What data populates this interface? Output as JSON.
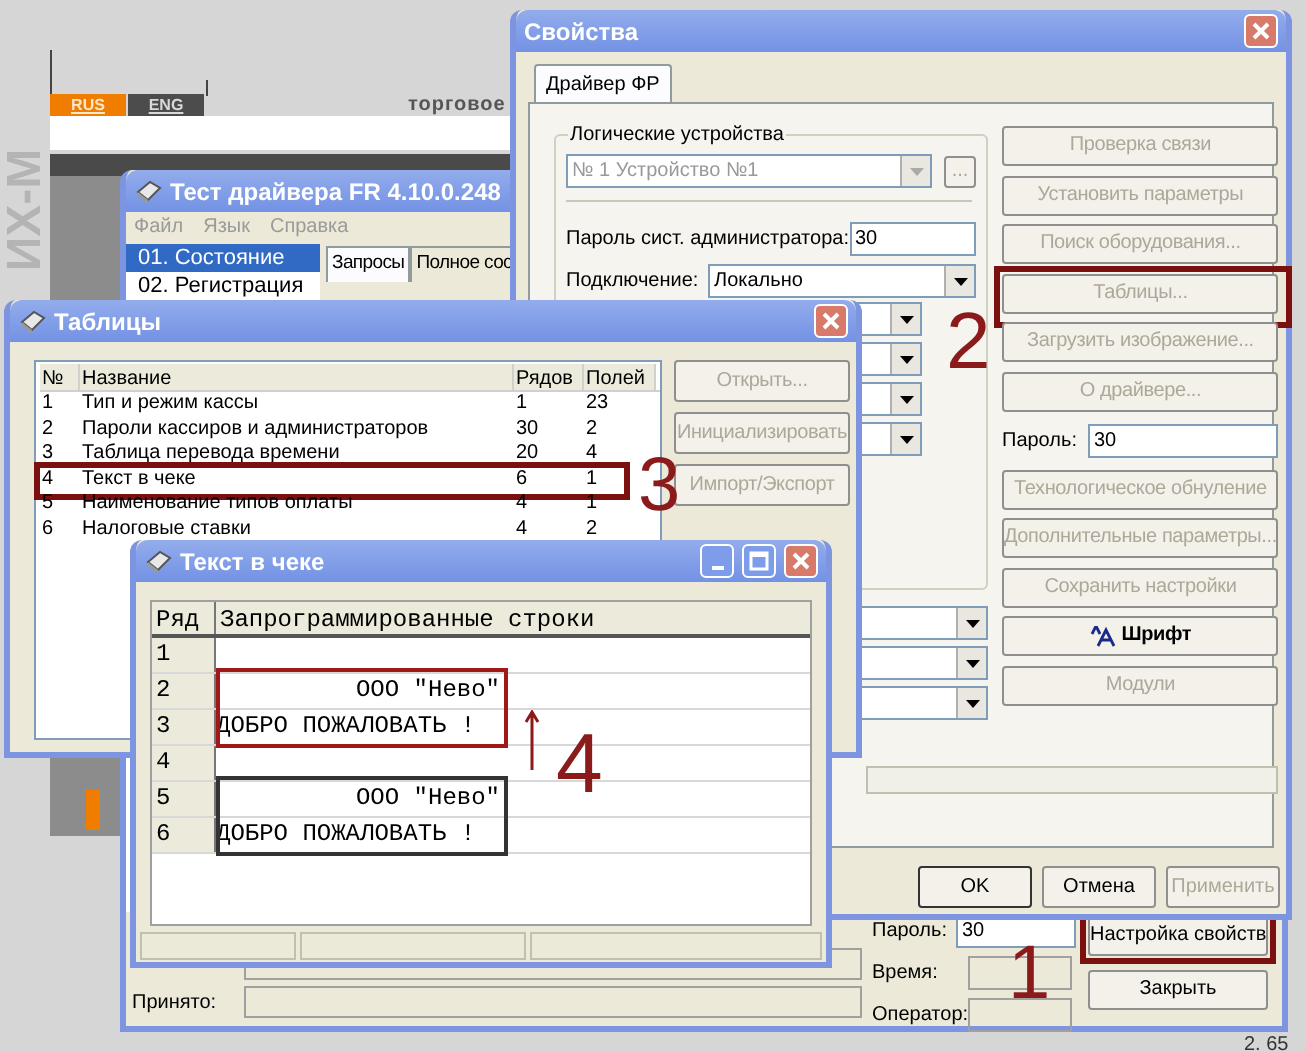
{
  "background": {
    "languages": [
      {
        "label": "RUS",
        "selected": true
      },
      {
        "label": "ENG",
        "selected": false
      }
    ],
    "tagline": "торговое",
    "logo": "ИХ-М",
    "corner_text": "2. 65"
  },
  "main_window": {
    "title": "Тест драйвера FR 4.10.0.248",
    "menu": [
      "Файл",
      "Язык",
      "Справка"
    ],
    "sections": [
      {
        "label": "01. Состояние",
        "selected": true
      },
      {
        "label": "02. Регистрация",
        "selected": false
      }
    ],
    "tabs": [
      {
        "label": "Запросы",
        "selected": true
      },
      {
        "label": "Полное сос",
        "selected": false
      }
    ],
    "fields": [
      {
        "label": "Принято:"
      }
    ],
    "password": {
      "label": "Пароль:",
      "value": "30"
    },
    "time_label": "Время:",
    "operator_label": "Оператор:",
    "buttons": [
      {
        "label": "Настройка свойств",
        "highlighted": true,
        "callout": "1"
      },
      {
        "label": "Закрыть",
        "highlighted": false
      }
    ]
  },
  "properties_window": {
    "title": "Свойства",
    "tabs": [
      {
        "label": "Драйвер ФР",
        "selected": true
      }
    ],
    "group_title": "Логические устройства",
    "device": {
      "value": "№ 1 Устройство №1",
      "disabled": true
    },
    "browse_label": "...",
    "admin_password": {
      "label": "Пароль сист. администратора:",
      "value": "30"
    },
    "connection": {
      "label": "Подключение:",
      "value": "Локально"
    },
    "actions": [
      {
        "kind": "button",
        "label": "Проверка связи",
        "disabled": true,
        "highlighted": false
      },
      {
        "kind": "button",
        "label": "Установить параметры",
        "disabled": true,
        "highlighted": false
      },
      {
        "kind": "button",
        "label": "Поиск оборудования...",
        "disabled": true,
        "highlighted": false
      },
      {
        "kind": "button",
        "label": "Таблицы...",
        "disabled": true,
        "highlighted": true,
        "callout": "2"
      },
      {
        "kind": "button",
        "label": "Загрузить изображение...",
        "disabled": true,
        "highlighted": false
      },
      {
        "kind": "button",
        "label": "О драйвере...",
        "disabled": true,
        "highlighted": false
      },
      {
        "kind": "password",
        "label": "Пароль:",
        "value": "30"
      },
      {
        "kind": "button",
        "label": "Технологическое обнуление",
        "disabled": true,
        "highlighted": false
      },
      {
        "kind": "button",
        "label": "Дополнительные параметры...",
        "disabled": true,
        "highlighted": false
      },
      {
        "kind": "button",
        "label": "Сохранить настройки",
        "disabled": true,
        "highlighted": false
      },
      {
        "kind": "font",
        "label": "Шрифт",
        "disabled": false,
        "highlighted": false
      },
      {
        "kind": "button",
        "label": "Модули",
        "disabled": true,
        "highlighted": false
      }
    ],
    "footer_buttons": [
      {
        "label": "OK",
        "disabled": false
      },
      {
        "label": "Отмена",
        "disabled": false
      },
      {
        "label": "Применить",
        "disabled": true
      }
    ]
  },
  "tables_window": {
    "title": "Таблицы",
    "columns": [
      "№",
      "Название",
      "Рядов",
      "Полей"
    ],
    "rows": [
      {
        "number": "1",
        "name": "Тип и режим кассы",
        "rows": "1",
        "fields": "23",
        "highlighted": false
      },
      {
        "number": "2",
        "name": "Пароли кассиров и администраторов",
        "rows": "30",
        "fields": "2",
        "highlighted": false
      },
      {
        "number": "3",
        "name": "Таблица перевода времени",
        "rows": "20",
        "fields": "4",
        "highlighted": false
      },
      {
        "number": "4",
        "name": "Текст в чеке",
        "rows": "6",
        "fields": "1",
        "highlighted": true,
        "callout": "3"
      },
      {
        "number": "5",
        "name": "Наименование типов оплаты",
        "rows": "4",
        "fields": "1",
        "highlighted": false
      },
      {
        "number": "6",
        "name": "Налоговые ставки",
        "rows": "4",
        "fields": "2",
        "highlighted": false
      }
    ],
    "buttons": [
      {
        "label": "Открыть...",
        "disabled": true
      },
      {
        "label": "Инициализировать",
        "disabled": true
      },
      {
        "label": "Импорт/Экспорт",
        "disabled": true
      }
    ]
  },
  "receipt_window": {
    "title": "Текст в чеке",
    "columns": [
      "Ряд",
      "Запрограммированные строки"
    ],
    "rows": [
      {
        "number": "1"
      },
      {
        "number": "2",
        "text": "ООО \"Нево\"",
        "kind": "right",
        "color": "#a01818"
      },
      {
        "number": "3",
        "text": "ДОБРО ПОЖАЛОВАТЬ !",
        "kind": "left",
        "color": "#a01818"
      },
      {
        "number": "4"
      },
      {
        "number": "5",
        "text": "ООО \"Нево\"",
        "kind": "right",
        "color": "#333333"
      },
      {
        "number": "6",
        "text": "ДОБРО ПОЖАЛОВАТЬ !",
        "kind": "left",
        "color": "#333333"
      }
    ],
    "callout": "4"
  }
}
